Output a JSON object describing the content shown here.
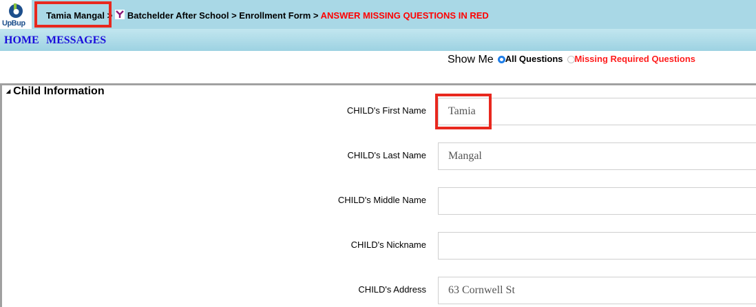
{
  "logo": {
    "text_main": "UpBup"
  },
  "breadcrumb": {
    "user": "Tamia Mangal",
    "sep1": " > ",
    "program": "Batchelder After School",
    "sep2": " > ",
    "form": "Enrollment Form",
    "sep3": " > ",
    "notice": "ANSWER MISSING QUESTIONS IN RED"
  },
  "nav": {
    "home": "HOME",
    "messages": "MESSAGES"
  },
  "show_me": {
    "label": "Show Me",
    "options": [
      {
        "label": "All Questions",
        "selected": true
      },
      {
        "label": "Missing Required Questions",
        "selected": false
      }
    ]
  },
  "section": {
    "title": "Child Information"
  },
  "fields": [
    {
      "label": "CHILD's First Name",
      "value": "Tamia"
    },
    {
      "label": "CHILD's Last Name",
      "value": "Mangal"
    },
    {
      "label": "CHILD's Middle Name",
      "value": ""
    },
    {
      "label": "CHILD's Nickname",
      "value": ""
    },
    {
      "label": "CHILD's Address",
      "value": "63 Cornwell St"
    }
  ],
  "colors": {
    "topbar": "#a9d8e6",
    "highlight": "#e8281e",
    "required_red": "#ff0000",
    "link_blue": "#1a0ddb"
  }
}
